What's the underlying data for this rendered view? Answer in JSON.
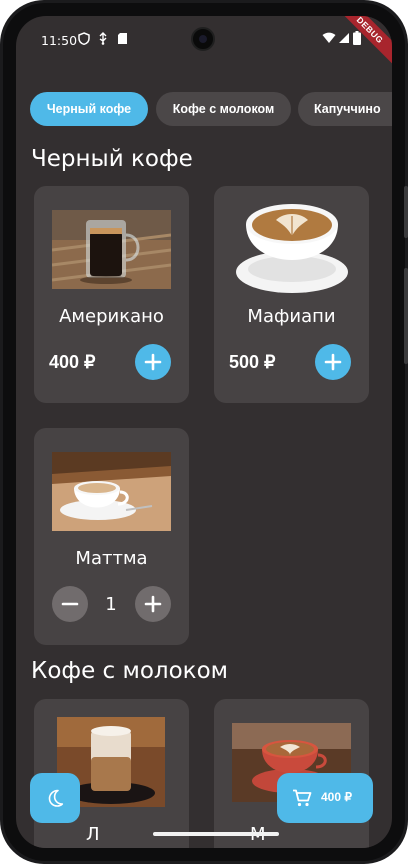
{
  "status_bar": {
    "time": "11:50",
    "icons": [
      "shield-icon",
      "usb-icon",
      "sd-card-icon",
      "wifi-icon",
      "signal-icon",
      "battery-icon"
    ],
    "debug_label": "DEBUG"
  },
  "categories": [
    {
      "label": "Черный кофе",
      "active": true
    },
    {
      "label": "Кофе с молоком",
      "active": false
    },
    {
      "label": "Капуччино",
      "active": false
    }
  ],
  "sections": [
    {
      "title": "Черный кофе",
      "items": [
        {
          "name": "Американо",
          "price": "400 ₽",
          "in_cart": false
        },
        {
          "name": "Мафиапи",
          "price": "500 ₽",
          "in_cart": false
        },
        {
          "name": "Маттма",
          "quantity": "1",
          "in_cart": true
        }
      ]
    },
    {
      "title": "Кофе с молоком",
      "items": [
        {
          "name": "Л"
        },
        {
          "name": "М"
        }
      ]
    }
  ],
  "cart": {
    "total": "400 ₽"
  },
  "colors": {
    "accent": "#4fb9e8",
    "background": "#332f30",
    "card": "#474344",
    "chip": "#4b4748"
  }
}
